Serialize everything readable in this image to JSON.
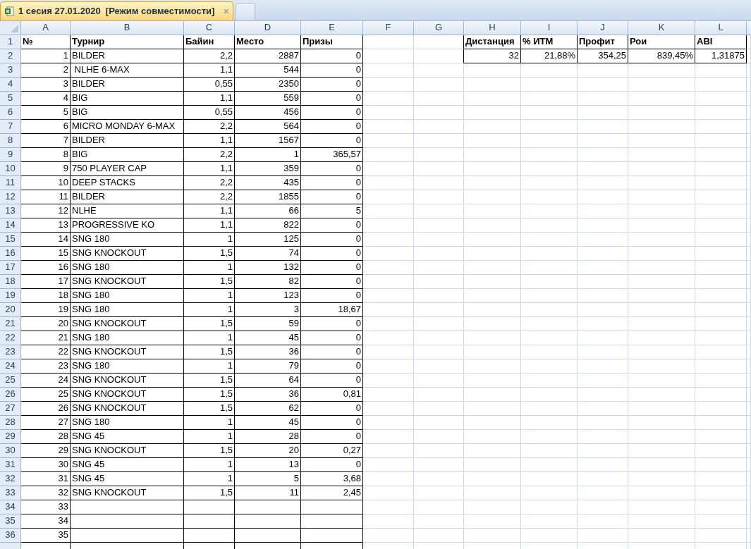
{
  "tabs": [
    {
      "title": "1 сесия 27.01.2020  [Режим совместимости]",
      "close": "×",
      "selected": true
    },
    {
      "selected": false
    }
  ],
  "sheet": {
    "columns": [
      "A",
      "B",
      "C",
      "D",
      "E",
      "F",
      "G",
      "H",
      "I",
      "J",
      "K",
      "L"
    ],
    "row_numbers": [
      "1",
      "2",
      "3",
      "4",
      "5",
      "6",
      "7",
      "8",
      "9",
      "10",
      "11",
      "12",
      "13",
      "14",
      "15",
      "16",
      "17",
      "18",
      "19",
      "20",
      "21",
      "22",
      "23",
      "24",
      "25",
      "26",
      "27",
      "28",
      "29",
      "30",
      "31",
      "32",
      "33",
      "34",
      "35",
      "36"
    ],
    "table": {
      "header": [
        "№",
        "Турнир",
        "Байин",
        "Место",
        "Призы"
      ],
      "rows": [
        [
          "1",
          "BILDER",
          "2,2",
          "2887",
          "0"
        ],
        [
          "2",
          " NLHE 6-MAX",
          "1,1",
          "544",
          "0"
        ],
        [
          "3",
          "BILDER",
          "0,55",
          "2350",
          "0"
        ],
        [
          "4",
          "BIG",
          "1,1",
          "559",
          "0"
        ],
        [
          "5",
          "BIG",
          "0,55",
          "456",
          "0"
        ],
        [
          "6",
          "MICRO MONDAY 6-MAX",
          "2,2",
          "564",
          "0"
        ],
        [
          "7",
          "BILDER",
          "1,1",
          "1567",
          "0"
        ],
        [
          "8",
          "BIG",
          "2,2",
          "1",
          "365,57"
        ],
        [
          "9",
          "750 PLAYER CAP",
          "1,1",
          "359",
          "0"
        ],
        [
          "10",
          "DEEP STACKS",
          "2,2",
          "435",
          "0"
        ],
        [
          "11",
          "BILDER",
          "2,2",
          "1855",
          "0"
        ],
        [
          "12",
          "NLHE",
          "1,1",
          "66",
          "5"
        ],
        [
          "13",
          "PROGRESSIVE KO",
          "1,1",
          "822",
          "0"
        ],
        [
          "14",
          "SNG 180",
          "1",
          "125",
          "0"
        ],
        [
          "15",
          "SNG KNOCKOUT",
          "1,5",
          "74",
          "0"
        ],
        [
          "16",
          "SNG 180",
          "1",
          "132",
          "0"
        ],
        [
          "17",
          "SNG KNOCKOUT",
          "1,5",
          "82",
          "0"
        ],
        [
          "18",
          "SNG 180",
          "1",
          "123",
          "0"
        ],
        [
          "19",
          "SNG 180",
          "1",
          "3",
          "18,67"
        ],
        [
          "20",
          "SNG KNOCKOUT",
          "1,5",
          "59",
          "0"
        ],
        [
          "21",
          "SNG 180",
          "1",
          "45",
          "0"
        ],
        [
          "22",
          "SNG KNOCKOUT",
          "1,5",
          "36",
          "0"
        ],
        [
          "23",
          "SNG 180",
          "1",
          "79",
          "0"
        ],
        [
          "24",
          "SNG KNOCKOUT",
          "1,5",
          "64",
          "0"
        ],
        [
          "25",
          "SNG KNOCKOUT",
          "1,5",
          "36",
          "0,81"
        ],
        [
          "26",
          "SNG KNOCKOUT",
          "1,5",
          "62",
          "0"
        ],
        [
          "27",
          "SNG 180",
          "1",
          "45",
          "0"
        ],
        [
          "28",
          "SNG 45",
          "1",
          "28",
          "0"
        ],
        [
          "29",
          "SNG KNOCKOUT",
          "1,5",
          "20",
          "0,27"
        ],
        [
          "30",
          "SNG 45",
          "1",
          "13",
          "0"
        ],
        [
          "31",
          "SNG 45",
          "1",
          "5",
          "3,68"
        ],
        [
          "32",
          "SNG KNOCKOUT",
          "1,5",
          "11",
          "2,45"
        ],
        [
          "33"
        ],
        [
          "34"
        ],
        [
          "35"
        ]
      ]
    },
    "summary": {
      "header": [
        "Дистанция",
        "% ИТМ",
        "Профит",
        "Рои",
        "ABI"
      ],
      "values": [
        "32",
        "21,88%",
        "354,25",
        "839,45%",
        "1,31875"
      ]
    }
  }
}
